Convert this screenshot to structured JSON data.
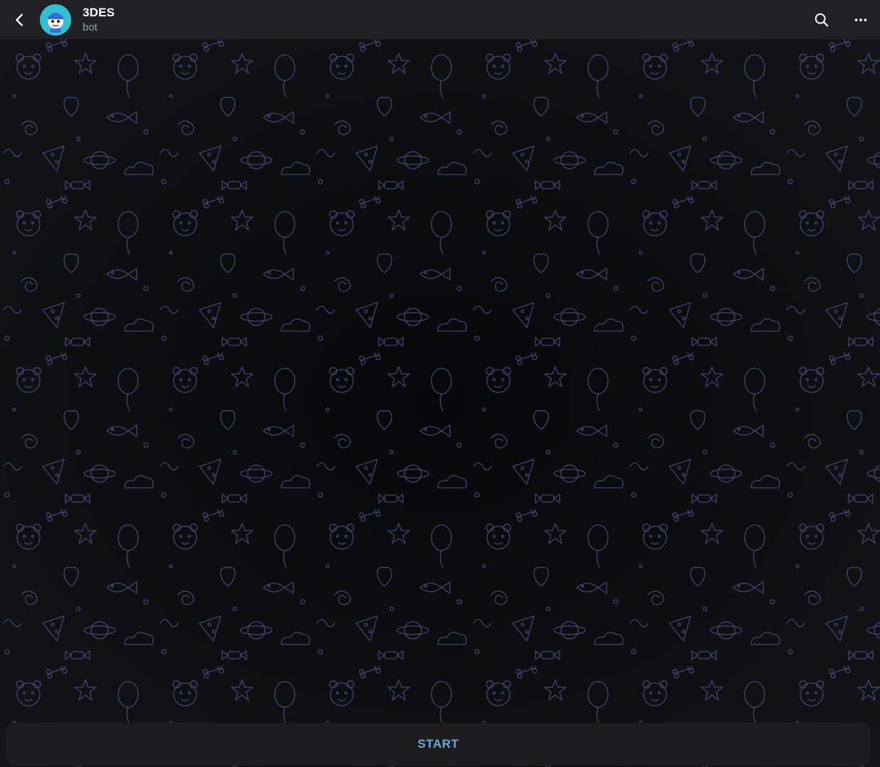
{
  "header": {
    "title": "3DES",
    "subtitle": "bot",
    "back_icon": "chevron-left-icon",
    "search_icon": "search-icon",
    "more_icon": "more-horizontal-icon"
  },
  "chat": {
    "background_color": "#0d0d0f",
    "doodle_color": "#5c5fa8"
  },
  "bottom": {
    "start_label": "START"
  },
  "colors": {
    "header_bg": "#212124",
    "accent": "#6fa8dc"
  }
}
